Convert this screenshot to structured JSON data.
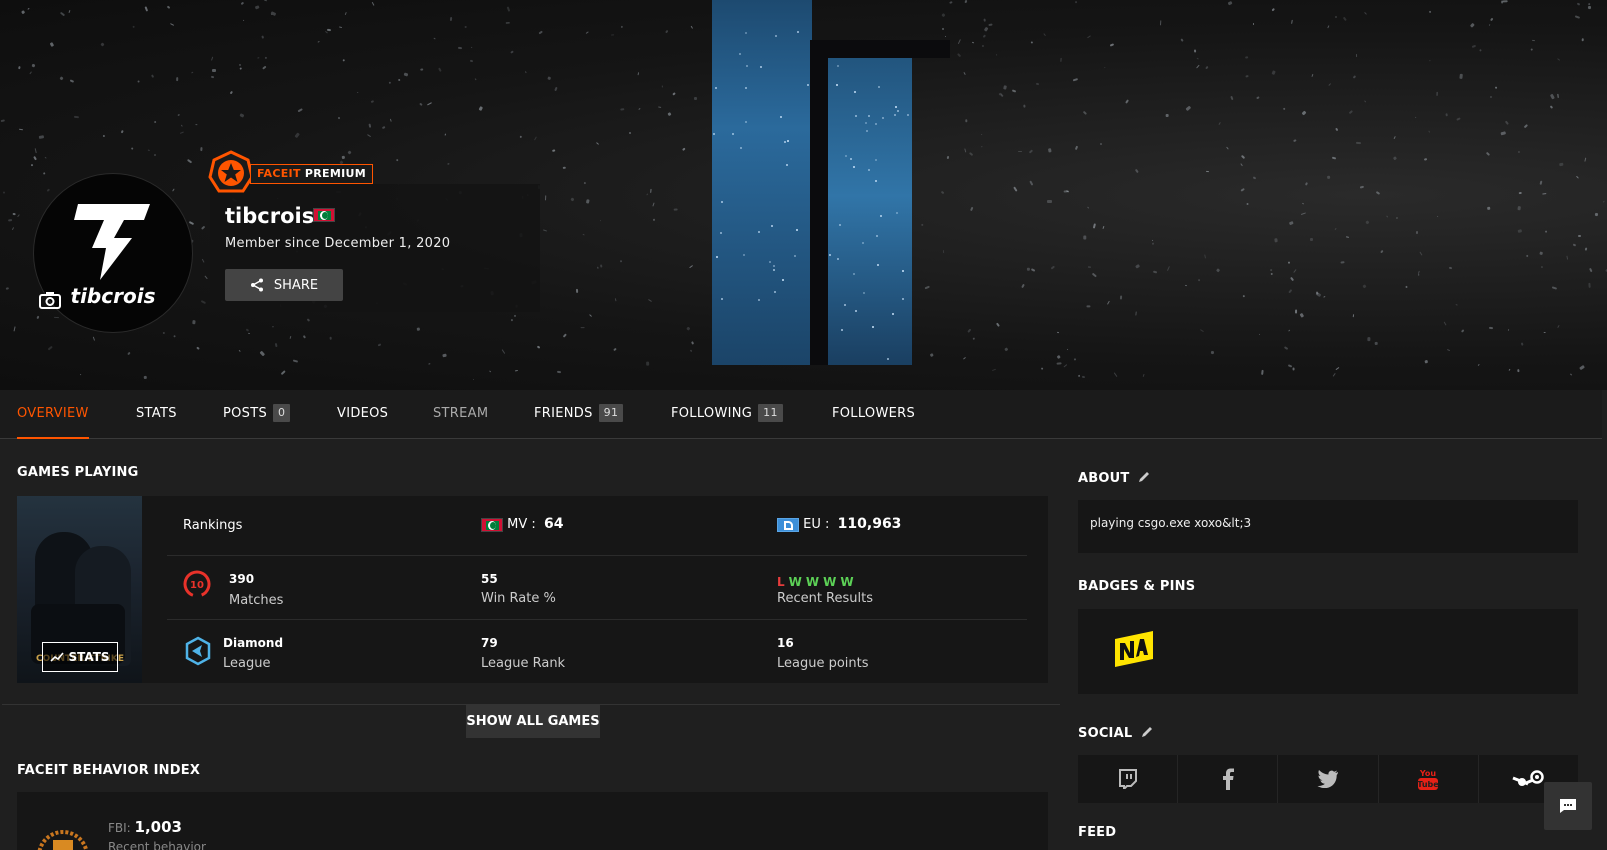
{
  "profile": {
    "premium_label_1": "FACEIT",
    "premium_label_2": "PREMIUM",
    "username": "tibcrois",
    "avatar_text": "tibcrois",
    "member_since": "Member since December 1, 2020",
    "share_label": "SHARE",
    "country_flag": "maldives-flag-icon"
  },
  "tabs": [
    {
      "label": "OVERVIEW",
      "active": true
    },
    {
      "label": "STATS"
    },
    {
      "label": "POSTS",
      "count": "0"
    },
    {
      "label": "VIDEOS"
    },
    {
      "label": "STREAM"
    },
    {
      "label": "FRIENDS",
      "count": "91"
    },
    {
      "label": "FOLLOWING",
      "count": "11"
    },
    {
      "label": "FOLLOWERS"
    }
  ],
  "games": {
    "title": "GAMES PLAYING",
    "cover_title": "COUNTER-STRIKE",
    "stats_label": "STATS",
    "rankings_label": "Rankings",
    "country_rank_code": "MV",
    "country_rank_value": "64",
    "region_rank_code": "EU",
    "region_rank_value": "110,963",
    "skill_level": "10",
    "matches_value": "390",
    "matches_label": "Matches",
    "win_rate_value": "55",
    "win_rate_label": "Win Rate %",
    "recent_results": [
      "L",
      "W",
      "W",
      "W",
      "W"
    ],
    "recent_results_label": "Recent Results",
    "league_value": "Diamond",
    "league_label": "League",
    "league_rank_value": "79",
    "league_rank_label": "League Rank",
    "league_points_value": "16",
    "league_points_label": "League points",
    "show_all_label": "SHOW ALL GAMES"
  },
  "fbi": {
    "title": "FACEIT BEHAVIOR INDEX",
    "label": "FBI:",
    "value": "1,003",
    "sub_label": "Recent behavior"
  },
  "about": {
    "title": "ABOUT",
    "text": "playing csgo.exe xoxo&lt;3"
  },
  "badges": {
    "title": "BADGES & PINS",
    "items": [
      "navi-badge-icon"
    ]
  },
  "social": {
    "title": "SOCIAL",
    "items": [
      "twitch-icon",
      "facebook-icon",
      "twitter-icon",
      "youtube-icon",
      "steam-icon"
    ]
  },
  "feed": {
    "title": "FEED"
  },
  "colors": {
    "accent": "#ff5500",
    "background": "#1f1f1f",
    "panel": "#161616",
    "win": "#5cd156",
    "loss": "#e63c3c"
  }
}
